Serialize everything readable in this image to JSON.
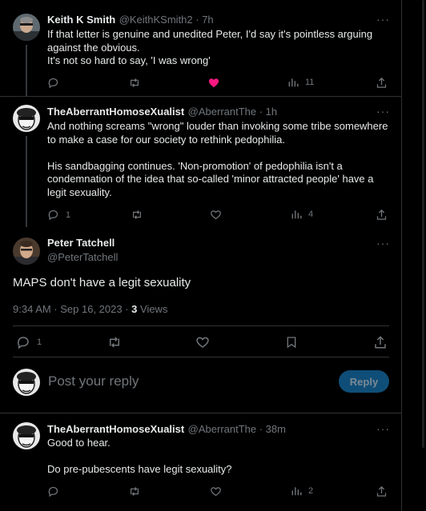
{
  "tweets": [
    {
      "name": "Keith K Smith",
      "handle": "@KeithKSmith2 · 7h",
      "text": "If that letter is genuine and unedited Peter, I'd say it's pointless arguing against the obvious.\nIt's not so hard to say, 'I was wrong'",
      "views": "11",
      "replies": "",
      "liked": true
    },
    {
      "name": "TheAberrantHomoseXualist",
      "handle": "@AberrantThe · 1h",
      "text": "And nothing screams \"wrong\" louder than invoking some tribe somewhere to make a case for our society to rethink pedophilia.\n\nHis sandbagging continues. 'Non-promotion' of pedophilia isn't a condemnation of the idea that so-called 'minor attracted people' have a legit sexuality.",
      "views": "4",
      "replies": "1"
    }
  ],
  "main_tweet": {
    "name": "Peter Tatchell",
    "handle": "@PeterTatchell",
    "text": "MAPS don't have a legit sexuality",
    "timestamp": "9:34 AM · Sep 16, 2023 · ",
    "views_count": "3",
    "views_label": " Views",
    "replies": "1"
  },
  "composer": {
    "placeholder": "Post your reply",
    "button": "Reply"
  },
  "reply_tweet": {
    "name": "TheAberrantHomoseXualist",
    "handle": "@AberrantThe · 38m",
    "text": "Good to hear.\n\nDo pre-pubescents have legit sexuality?",
    "views": "2"
  },
  "colors": {
    "background": "#000000",
    "text": "#e7e9ea",
    "muted": "#71767b",
    "like": "#f91880",
    "reply_button": "#0f4e78"
  },
  "more_glyph": "···"
}
